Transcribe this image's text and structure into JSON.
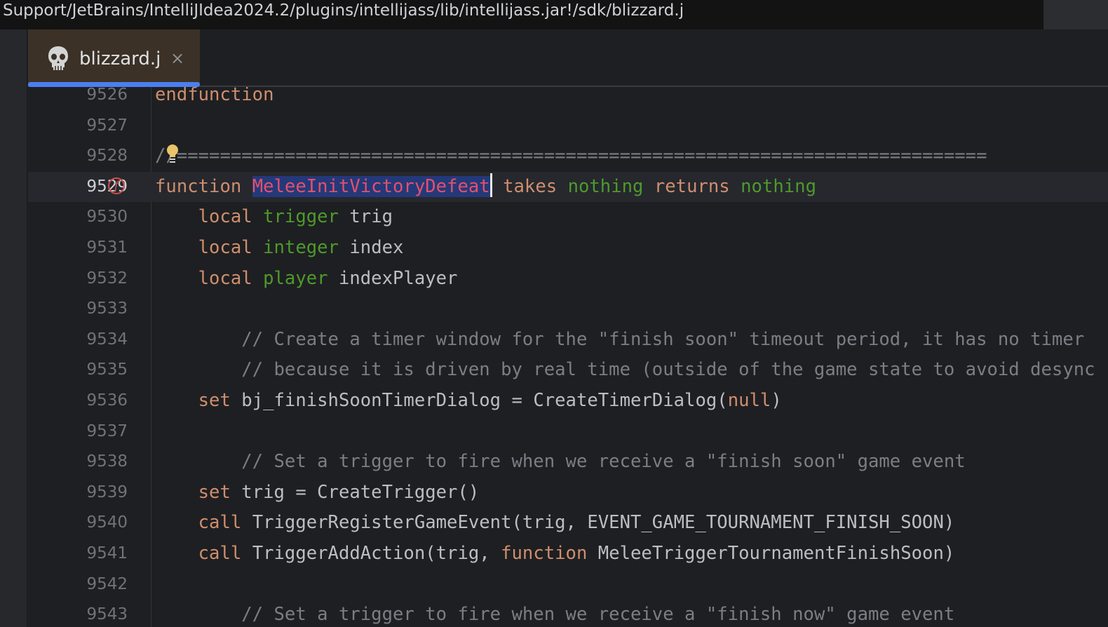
{
  "window": {
    "title_path": "Support/JetBrains/IntelliJIdea2024.2/plugins/intellijass/lib/intellijass.jar!/sdk/blizzard.j"
  },
  "tabs": [
    {
      "label": "blizzard.j",
      "icon": "skull-icon",
      "close": "×",
      "active": true
    }
  ],
  "colors": {
    "keyword": "#cf8e6d",
    "type": "#4e9a2b",
    "identifier": "#bcbec4",
    "comment": "#7a7e85",
    "function_name": "#e3506a",
    "selection": "#24397a",
    "tab_accent": "#4a7ff0"
  },
  "editor": {
    "current_line": 9529,
    "lines": [
      {
        "n": "9526",
        "t": [
          [
            "endfunction",
            "kw"
          ]
        ]
      },
      {
        "n": "9527",
        "t": []
      },
      {
        "n": "9528",
        "t": [
          [
            "//===========================================================================",
            "cm"
          ]
        ],
        "bulb": true
      },
      {
        "n": "9529",
        "t": [
          [
            "function ",
            "kw"
          ],
          [
            "MeleeInitVictoryDefeat",
            "fn"
          ],
          [
            "|caret",
            ""
          ],
          [
            " takes ",
            "kw"
          ],
          [
            "nothing",
            "ty"
          ],
          [
            " returns ",
            "kw"
          ],
          [
            "nothing",
            "ty"
          ]
        ],
        "marker": "f"
      },
      {
        "n": "9530",
        "t": [
          [
            "    local ",
            "kw"
          ],
          [
            "trigger",
            "ty"
          ],
          [
            " trig",
            "id"
          ]
        ]
      },
      {
        "n": "9531",
        "t": [
          [
            "    local ",
            "kw"
          ],
          [
            "integer",
            "ty"
          ],
          [
            " index",
            "id"
          ]
        ]
      },
      {
        "n": "9532",
        "t": [
          [
            "    local ",
            "kw"
          ],
          [
            "player",
            "ty"
          ],
          [
            " indexPlayer",
            "id"
          ]
        ]
      },
      {
        "n": "9533",
        "t": []
      },
      {
        "n": "9534",
        "t": [
          [
            "        // Create a timer window for the \"finish soon\" timeout period, it has no timer",
            "cm"
          ]
        ]
      },
      {
        "n": "9535",
        "t": [
          [
            "        // because it is driven by real time (outside of the game state to avoid desync",
            "cm"
          ]
        ]
      },
      {
        "n": "9536",
        "t": [
          [
            "    set ",
            "kw"
          ],
          [
            "bj_finishSoonTimerDialog = CreateTimerDialog(",
            "id"
          ],
          [
            "null",
            "kw"
          ],
          [
            ")",
            "id"
          ]
        ]
      },
      {
        "n": "9537",
        "t": []
      },
      {
        "n": "9538",
        "t": [
          [
            "        // Set a trigger to fire when we receive a \"finish soon\" game event",
            "cm"
          ]
        ]
      },
      {
        "n": "9539",
        "t": [
          [
            "    set ",
            "kw"
          ],
          [
            "trig = CreateTrigger()",
            "id"
          ]
        ]
      },
      {
        "n": "9540",
        "t": [
          [
            "    call ",
            "kw"
          ],
          [
            "TriggerRegisterGameEvent(trig, EVENT_GAME_TOURNAMENT_FINISH_SOON)",
            "id"
          ]
        ]
      },
      {
        "n": "9541",
        "t": [
          [
            "    call ",
            "kw"
          ],
          [
            "TriggerAddAction(trig, ",
            "id"
          ],
          [
            "function",
            "kw"
          ],
          [
            " MeleeTriggerTournamentFinishSoon)",
            "id"
          ]
        ]
      },
      {
        "n": "9542",
        "t": []
      },
      {
        "n": "9543",
        "t": [
          [
            "        // Set a trigger to fire when we receive a \"finish now\" game event",
            "cm"
          ]
        ]
      }
    ]
  }
}
